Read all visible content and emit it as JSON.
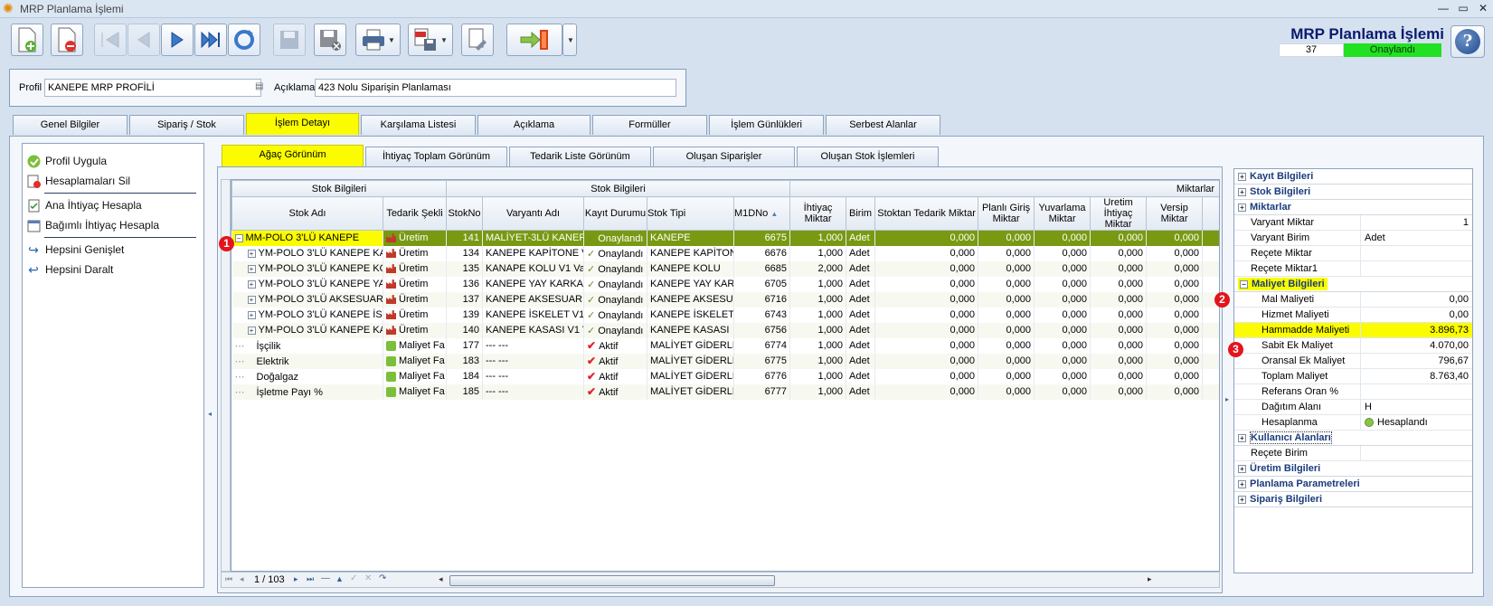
{
  "window": {
    "title": "MRP Planlama İşlemi"
  },
  "header": {
    "title": "MRP Planlama İşlemi",
    "number": "37",
    "status": "Onaylandı"
  },
  "profile": {
    "label": "Profil",
    "value": "KANEPE MRP PROFİLİ",
    "desc_label": "Açıklama",
    "desc_value": "423 Nolu Siparişin Planlaması"
  },
  "main_tabs": [
    "Genel Bilgiler",
    "Sipariş / Stok",
    "İşlem Detayı",
    "Karşılama Listesi",
    "Açıklama",
    "Formüller",
    "İşlem Günlükleri",
    "Serbest Alanlar"
  ],
  "sub_tabs": [
    "Ağaç Görünüm",
    "İhtiyaç Toplam Görünüm",
    "Tedarik Liste Görünüm",
    "Oluşan Siparişler",
    "Oluşan Stok İşlemleri"
  ],
  "left_actions": [
    "Profil Uygula",
    "Hesaplamaları Sil",
    "Ana İhtiyaç Hesapla",
    "Bağımlı İhtiyaç Hesapla",
    "Hepsini Genişlet",
    "Hepsini Daralt"
  ],
  "grid": {
    "band_headers": [
      "Stok Bilgileri",
      "Stok Bilgileri",
      "Miktarlar"
    ],
    "columns": [
      "Stok Adı",
      "Tedarik Şekli",
      "StokNo",
      "Varyantı Adı",
      "Kayıt Durumu",
      "Stok Tipi",
      "M1DNo",
      "İhtiyaç Miktar",
      "Birim",
      "Stoktan Tedarik Miktar",
      "Planlı Giriş Miktar",
      "Yuvarlama Miktar",
      "Uretim İhtiyaç Miktar",
      "Versip Miktar"
    ],
    "rows": [
      {
        "name": "MM-POLO 3'LÜ KANEPE",
        "supply": "Üretim",
        "stokno": "141",
        "variant": "MALİYET-3LÜ KANEPE",
        "state": "Onaylandı",
        "type": "KANEPE",
        "m1dno": "6675",
        "need": "1,000",
        "unit": "Adet",
        "s1": "0,000",
        "s2": "0,000",
        "s3": "0,000",
        "s4": "0,000",
        "s5": "0,000"
      },
      {
        "name": "YM-POLO 3'LÜ KANEPE KAPİ",
        "supply": "Üretim",
        "stokno": "134",
        "variant": "KANEPE KAPİTONE V1",
        "state": "Onaylandı",
        "type": "KANEPE KAPİTONE",
        "m1dno": "6676",
        "need": "1,000",
        "unit": "Adet",
        "s1": "0,000",
        "s2": "0,000",
        "s3": "0,000",
        "s4": "0,000",
        "s5": "0,000"
      },
      {
        "name": "YM-POLO 3'LÜ KANEPE KOL",
        "supply": "Üretim",
        "stokno": "135",
        "variant": "KANAPE KOLU V1 Vary",
        "state": "Onaylandı",
        "type": "KANEPE KOLU",
        "m1dno": "6685",
        "need": "2,000",
        "unit": "Adet",
        "s1": "0,000",
        "s2": "0,000",
        "s3": "0,000",
        "s4": "0,000",
        "s5": "0,000"
      },
      {
        "name": "YM-POLO 3'LÜ KANEPE YAY",
        "supply": "Üretim",
        "stokno": "136",
        "variant": "KANEPE YAY KARKASI",
        "state": "Onaylandı",
        "type": "KANEPE YAY KARKA",
        "m1dno": "6705",
        "need": "1,000",
        "unit": "Adet",
        "s1": "0,000",
        "s2": "0,000",
        "s3": "0,000",
        "s4": "0,000",
        "s5": "0,000"
      },
      {
        "name": "YM-POLO 3'LÜ AKSESUAR",
        "supply": "Üretim",
        "stokno": "137",
        "variant": "KANEPE AKSESUAR PA",
        "state": "Onaylandı",
        "type": "KANEPE AKSESUAR",
        "m1dno": "6716",
        "need": "1,000",
        "unit": "Adet",
        "s1": "0,000",
        "s2": "0,000",
        "s3": "0,000",
        "s4": "0,000",
        "s5": "0,000"
      },
      {
        "name": "YM-POLO 3'LÜ KANEPE İSKE",
        "supply": "Üretim",
        "stokno": "139",
        "variant": "KANEPE İSKELET V1 V",
        "state": "Onaylandı",
        "type": "KANEPE İSKELETİ",
        "m1dno": "6743",
        "need": "1,000",
        "unit": "Adet",
        "s1": "0,000",
        "s2": "0,000",
        "s3": "0,000",
        "s4": "0,000",
        "s5": "0,000"
      },
      {
        "name": "YM-POLO 3'LÜ KANEPE KASA",
        "supply": "Üretim",
        "stokno": "140",
        "variant": "KANEPE KASASI V1 Va",
        "state": "Onaylandı",
        "type": "KANEPE KASASI",
        "m1dno": "6756",
        "need": "1,000",
        "unit": "Adet",
        "s1": "0,000",
        "s2": "0,000",
        "s3": "0,000",
        "s4": "0,000",
        "s5": "0,000"
      },
      {
        "name": "İşçilik",
        "supply": "Maliyet Fa",
        "stokno": "177",
        "variant": "--- ---",
        "state": "Aktif",
        "type": "MALİYET GİDERLER",
        "m1dno": "6774",
        "need": "1,000",
        "unit": "Adet",
        "s1": "0,000",
        "s2": "0,000",
        "s3": "0,000",
        "s4": "0,000",
        "s5": "0,000"
      },
      {
        "name": "Elektrik",
        "supply": "Maliyet Fa",
        "stokno": "183",
        "variant": "--- ---",
        "state": "Aktif",
        "type": "MALİYET GİDERLER",
        "m1dno": "6775",
        "need": "1,000",
        "unit": "Adet",
        "s1": "0,000",
        "s2": "0,000",
        "s3": "0,000",
        "s4": "0,000",
        "s5": "0,000"
      },
      {
        "name": "Doğalgaz",
        "supply": "Maliyet Fa",
        "stokno": "184",
        "variant": "--- ---",
        "state": "Aktif",
        "type": "MALİYET GİDERLER",
        "m1dno": "6776",
        "need": "1,000",
        "unit": "Adet",
        "s1": "0,000",
        "s2": "0,000",
        "s3": "0,000",
        "s4": "0,000",
        "s5": "0,000"
      },
      {
        "name": "İşletme Payı %",
        "supply": "Maliyet Fa",
        "stokno": "185",
        "variant": "--- ---",
        "state": "Aktif",
        "type": "MALİYET GİDERLER",
        "m1dno": "6777",
        "need": "1,000",
        "unit": "Adet",
        "s1": "0,000",
        "s2": "0,000",
        "s3": "0,000",
        "s4": "0,000",
        "s5": "0,000"
      }
    ],
    "pager": "1 / 103"
  },
  "properties": {
    "kayit": "Kayıt Bilgileri",
    "stok": "Stok Bilgileri",
    "miktarlar": "Miktarlar",
    "miktar_rows": [
      {
        "k": "Varyant Miktar",
        "v": "1"
      },
      {
        "k": "Varyant Birim",
        "v": "Adet"
      },
      {
        "k": "Reçete Miktar",
        "v": ""
      },
      {
        "k": "Reçete Miktar1",
        "v": ""
      }
    ],
    "maliyet": "Maliyet Bilgileri",
    "maliyet_rows": [
      {
        "k": "Mal Maliyeti",
        "v": "0,00"
      },
      {
        "k": "Hizmet Maliyeti",
        "v": "0,00"
      },
      {
        "k": "Hammadde Maliyeti",
        "v": "3.896,73"
      },
      {
        "k": "Sabit Ek Maliyet",
        "v": "4.070,00"
      },
      {
        "k": "Oransal Ek Maliyet",
        "v": "796,67"
      },
      {
        "k": "Toplam Maliyet",
        "v": "8.763,40"
      },
      {
        "k": "Referans Oran %",
        "v": ""
      },
      {
        "k": "Dağıtım Alanı",
        "v": "H"
      },
      {
        "k": "Hesaplanma",
        "v": "Hesaplandı"
      }
    ],
    "kullanici": "Kullanıcı Alanları",
    "recete_birim": "Reçete Birim",
    "uretim": "Üretim Bilgileri",
    "planlama": "Planlama Parametreleri",
    "siparis": "Sipariş Bilgileri"
  },
  "badges": [
    "1",
    "2",
    "3"
  ],
  "colors": {
    "highlight": "#fbfc00",
    "selected_row": "#799912",
    "approved": "#22e022",
    "badge": "#e3141b"
  }
}
